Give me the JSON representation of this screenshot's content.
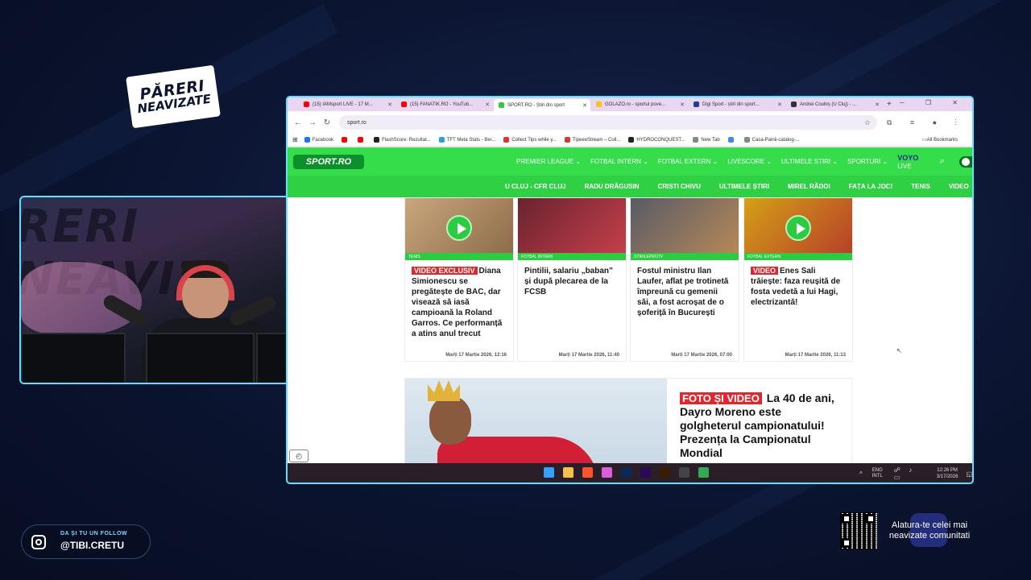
{
  "overlay": {
    "brand": {
      "line1": "PĂRERI",
      "line2": "NEAVIZATE"
    },
    "social": {
      "cta": "DA ȘI TU UN FOLLOW",
      "handle": "@TIBI.CRETU"
    },
    "join_text": "Alatura-te celei mai neavizate comunitati"
  },
  "browser": {
    "tabs": [
      {
        "label": "(15) IAMsport LIVE - 17 M...",
        "favicon_color": "#ff0000",
        "active": false
      },
      {
        "label": "(15) FANATIK.RO - YouTub...",
        "favicon_color": "#ff0000",
        "active": false
      },
      {
        "label": "SPORT.RO - Știri din sport",
        "favicon_color": "#2ccb41",
        "active": true
      },
      {
        "label": "GOLAZO.ro - sportul pove...",
        "favicon_color": "#f5c518",
        "active": false
      },
      {
        "label": "Digi Sport - știri din sport...",
        "favicon_color": "#1d3f8f",
        "active": false
      },
      {
        "label": "Andrei Coubiș (U Cluj) - ...",
        "favicon_color": "#333333",
        "active": false
      }
    ],
    "new_tab_icon": "plus-icon",
    "url": "sport.ro",
    "bookmarks": [
      {
        "label": "Facebook",
        "color": "#1877f2"
      },
      {
        "label": "",
        "color": "#ff0000"
      },
      {
        "label": "",
        "color": "#ff0000"
      },
      {
        "label": "FlashScore: Rezultat...",
        "color": "#222222"
      },
      {
        "label": "TFT Meta Stats - Ber...",
        "color": "#2a9fd8"
      },
      {
        "label": "Collect Tips while y...",
        "color": "#d33"
      },
      {
        "label": "TipeeeStream – Coll...",
        "color": "#d33"
      },
      {
        "label": "HYDROCONQUEST...",
        "color": "#222"
      },
      {
        "label": "New Tab",
        "color": "#888"
      },
      {
        "label": "",
        "color": "#4285f4"
      },
      {
        "label": "Casa-Painii-catalog-...",
        "color": "#888"
      }
    ],
    "all_bookmarks": "All Bookmarks"
  },
  "site": {
    "logo": "SPORT.RO",
    "menu_primary": [
      "PREMIER LEAGUE",
      "FOTBAL INTERN",
      "FOTBAL EXTERN",
      "LIVESCORE",
      "ULTIMELE STIRI",
      "SPORTURI"
    ],
    "voyo": {
      "brand": "VOYO",
      "suffix": " LIVE"
    },
    "menu_secondary": [
      "U CLUJ - CFR CLUJ",
      "RADU DRĂGUSIN",
      "CRISTI CHIVU",
      "ULTIMELE ȘTIRI",
      "MIREL RĂDOI",
      "FAȚA LA JOC!",
      "TENIS",
      "VIDEO"
    ],
    "cards": [
      {
        "tag": "TENIS",
        "badge": "VIDEO EXCLUSIV",
        "title": "Diana Simionescu se pregătește de BAC, dar visează să iasă campioană la Roland Garros. Ce performanță a atins anul trecut",
        "date": "Marți 17 Martie 2026, 12:16",
        "has_play": true
      },
      {
        "tag": "FOTBAL INTERN",
        "badge": "",
        "title": "Pintilii, salariu „baban” și după plecarea de la FCSB",
        "date": "Marți 17 Martie 2026, 11:40",
        "has_play": false
      },
      {
        "tag": "STIRILEPROTV",
        "badge": "",
        "title": "Fostul ministru Ilan Laufer, aflat pe trotinetă împreună cu gemenii săi, a fost acroșat de o șoferiță în București",
        "date": "Marți 17 Martie 2026, 07:00",
        "has_play": false
      },
      {
        "tag": "FOTBAL EXTERN",
        "badge": "VIDEO",
        "title": "Enes Sali trăiește: faza reușită de fosta vedetă a lui Hagi, electrizantă!",
        "date": "Marți 17 Martie 2026, 11:13",
        "has_play": true
      }
    ],
    "feature": {
      "badge": "FOTO ȘI VIDEO",
      "title": "La 40 de ani, Dayro Moreno este golgheterul campionatului! Prezența la Campionatul Mondial"
    }
  },
  "taskbar": {
    "apps": [
      {
        "name": "windows-start-icon",
        "color": "#3aa0ff"
      },
      {
        "name": "file-explorer-icon",
        "color": "#f2c14e"
      },
      {
        "name": "brave-icon",
        "color": "#fb542b"
      },
      {
        "name": "photos-icon",
        "color": "#d85fd6"
      },
      {
        "name": "photoshop-icon",
        "color": "#0a2a55"
      },
      {
        "name": "premiere-icon",
        "color": "#2a0a55"
      },
      {
        "name": "illustrator-icon",
        "color": "#3a1d00"
      },
      {
        "name": "obs-icon",
        "color": "#444444"
      },
      {
        "name": "chrome-icon",
        "color": "#34a853"
      }
    ],
    "lang_line1": "ENG",
    "lang_line2": "INTL",
    "time": "12:26 PM",
    "date": "3/17/2026"
  }
}
